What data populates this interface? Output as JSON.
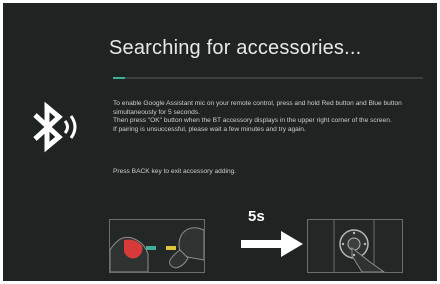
{
  "screen": {
    "title": "Searching for accessories...",
    "progress": 0.04,
    "instructions": [
      "To enable Google Assistant mic on your remote control, press and hold Red button and Blue button simultaneously for 5 seconds.",
      "Then press \"OK\" button when the BT accessory displays in the upper right corner of the screen.",
      "If pairing is unsuccessful, please wait a few minutes and try again."
    ],
    "back_hint": "Press BACK key to exit accessory adding.",
    "step_label": "5s",
    "icons": {
      "left": "bluetooth-icon",
      "arrow": "arrow-right-icon",
      "illustration_left": "remote-red-blue-buttons-illustration",
      "illustration_right": "remote-ok-button-illustration"
    },
    "colors": {
      "background": "#1f2322",
      "progress_accent": "#3fae9a",
      "red_button": "#d63a3a",
      "blue_button_marker": "#3fae9a",
      "yellow_button_marker": "#d9c53a"
    }
  }
}
